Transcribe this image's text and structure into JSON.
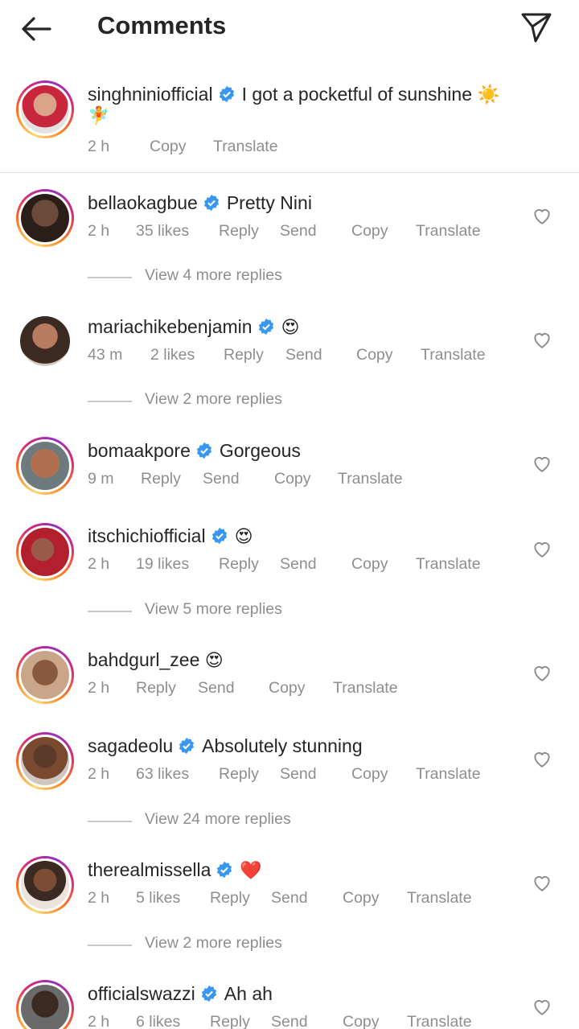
{
  "header": {
    "title": "Comments"
  },
  "caption": {
    "username": "singhniniofficial",
    "text": "I got a pocketful of sunshine ☀️",
    "emoji2": "🧚",
    "time": "2 h",
    "copy": "Copy",
    "translate": "Translate"
  },
  "comments": [
    {
      "username": "bellaokagbue",
      "text": "Pretty Nini",
      "time": "2 h",
      "likes": "35 likes",
      "reply": "Reply",
      "send": "Send",
      "copy": "Copy",
      "translate": "Translate",
      "view_replies": "View 4 more replies"
    },
    {
      "username": "mariachikebenjamin",
      "text": "😍",
      "time": "43 m",
      "likes": "2 likes",
      "reply": "Reply",
      "send": "Send",
      "copy": "Copy",
      "translate": "Translate",
      "view_replies": "View 2 more replies"
    },
    {
      "username": "bomaakpore",
      "text": "Gorgeous",
      "time": "9 m",
      "reply": "Reply",
      "send": "Send",
      "copy": "Copy",
      "translate": "Translate"
    },
    {
      "username": "itschichiofficial",
      "text": "😍",
      "time": "2 h",
      "likes": "19 likes",
      "reply": "Reply",
      "send": "Send",
      "copy": "Copy",
      "translate": "Translate",
      "view_replies": "View 5 more replies"
    },
    {
      "username": "bahdgurl_zee",
      "text": "😍",
      "time": "2 h",
      "reply": "Reply",
      "send": "Send",
      "copy": "Copy",
      "translate": "Translate"
    },
    {
      "username": "sagadeolu",
      "text": "Absolutely stunning",
      "time": "2 h",
      "likes": "63 likes",
      "reply": "Reply",
      "send": "Send",
      "copy": "Copy",
      "translate": "Translate",
      "view_replies": "View 24 more replies"
    },
    {
      "username": "therealmissella",
      "text": "❤️",
      "time": "2 h",
      "likes": "5 likes",
      "reply": "Reply",
      "send": "Send",
      "copy": "Copy",
      "translate": "Translate",
      "view_replies": "View 2 more replies"
    },
    {
      "username": "officialswazzi",
      "text": "Ah ah",
      "time": "2 h",
      "likes": "6 likes",
      "reply": "Reply",
      "send": "Send",
      "copy": "Copy",
      "translate": "Translate"
    }
  ]
}
